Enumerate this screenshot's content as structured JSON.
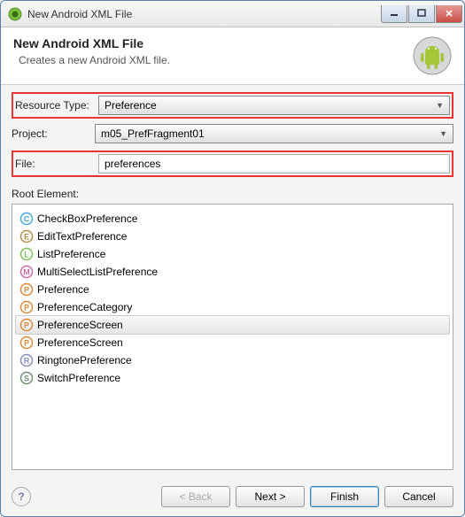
{
  "titlebar": {
    "title": "New Android XML File"
  },
  "banner": {
    "title": "New Android XML File",
    "subtitle": "Creates a new Android XML file."
  },
  "form": {
    "resourceType": {
      "label": "Resource Type:",
      "value": "Preference"
    },
    "project": {
      "label": "Project:",
      "value": "m05_PrefFragment01"
    },
    "file": {
      "label": "File:",
      "value": "preferences"
    }
  },
  "rootElement": {
    "label": "Root Element:",
    "items": [
      {
        "letter": "C",
        "color": "#46aadc",
        "name": "CheckBoxPreference",
        "selected": false
      },
      {
        "letter": "E",
        "color": "#b38f4e",
        "name": "EditTextPreference",
        "selected": false
      },
      {
        "letter": "L",
        "color": "#7fbf5e",
        "name": "ListPreference",
        "selected": false
      },
      {
        "letter": "M",
        "color": "#c96aa8",
        "name": "MultiSelectListPreference",
        "selected": false
      },
      {
        "letter": "P",
        "color": "#d98b3a",
        "name": "Preference",
        "selected": false
      },
      {
        "letter": "P",
        "color": "#d98b3a",
        "name": "PreferenceCategory",
        "selected": false
      },
      {
        "letter": "P",
        "color": "#d98b3a",
        "name": "PreferenceScreen",
        "selected": true
      },
      {
        "letter": "P",
        "color": "#d98b3a",
        "name": "PreferenceScreen",
        "selected": false
      },
      {
        "letter": "R",
        "color": "#7f8fb8",
        "name": "RingtonePreference",
        "selected": false
      },
      {
        "letter": "S",
        "color": "#6f8f6f",
        "name": "SwitchPreference",
        "selected": false
      }
    ]
  },
  "buttons": {
    "help": "?",
    "back": "< Back",
    "next": "Next >",
    "finish": "Finish",
    "cancel": "Cancel"
  }
}
